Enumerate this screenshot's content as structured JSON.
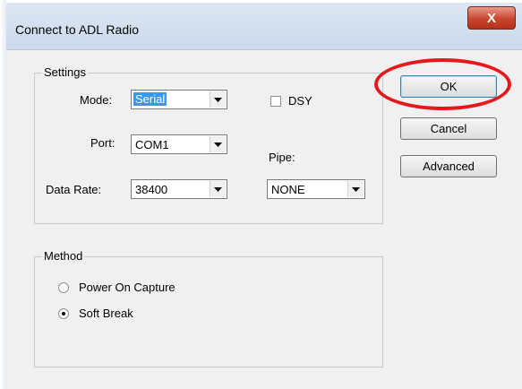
{
  "window": {
    "title": "Connect to ADL Radio",
    "close_glyph": "X"
  },
  "settings": {
    "group_label": "Settings",
    "mode_label": "Mode:",
    "mode_value": "Serial",
    "port_label": "Port:",
    "port_value": "COM1",
    "rate_label": "Data Rate:",
    "rate_value": "38400",
    "dsy_label": "DSY",
    "dsy_checked": false,
    "pipe_label": "Pipe:",
    "pipe_value": "NONE"
  },
  "method": {
    "group_label": "Method",
    "options": [
      {
        "label": "Power On Capture",
        "checked": false
      },
      {
        "label": "Soft Break",
        "checked": true
      }
    ]
  },
  "buttons": {
    "ok": "OK",
    "cancel": "Cancel",
    "advanced": "Advanced"
  },
  "colors": {
    "annotation_ring": "#e5181b",
    "selection": "#3399ff"
  }
}
